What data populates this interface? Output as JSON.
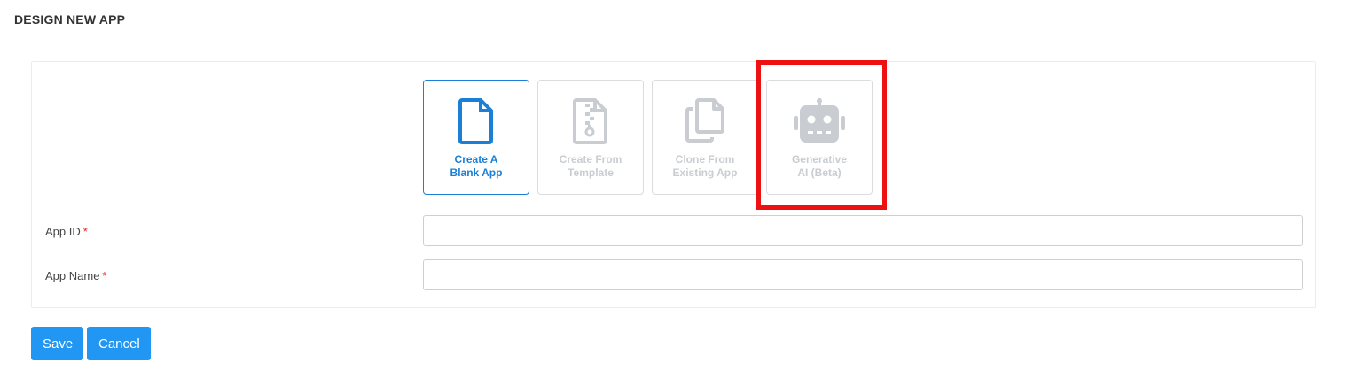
{
  "page": {
    "title": "DESIGN NEW APP"
  },
  "options": [
    {
      "id": "blank",
      "label": "Create A\nBlank App",
      "icon": "file-icon",
      "selected": true
    },
    {
      "id": "template",
      "label": "Create From\nTemplate",
      "icon": "file-archive-icon",
      "selected": false
    },
    {
      "id": "clone",
      "label": "Clone From\nExisting App",
      "icon": "copy-icon",
      "selected": false
    },
    {
      "id": "generative",
      "label": "Generative\nAI (Beta)",
      "icon": "robot-icon",
      "selected": false
    }
  ],
  "form": {
    "app_id": {
      "label": "App ID",
      "required_mark": "*",
      "value": "",
      "placeholder": ""
    },
    "app_name": {
      "label": "App Name",
      "required_mark": "*",
      "value": "",
      "placeholder": ""
    }
  },
  "actions": {
    "save_label": "Save",
    "cancel_label": "Cancel"
  },
  "colors": {
    "accent": "#1a7fd6",
    "button": "#2196f3",
    "disabled_icon": "#c9cdd2",
    "highlight": "#ee1111"
  }
}
